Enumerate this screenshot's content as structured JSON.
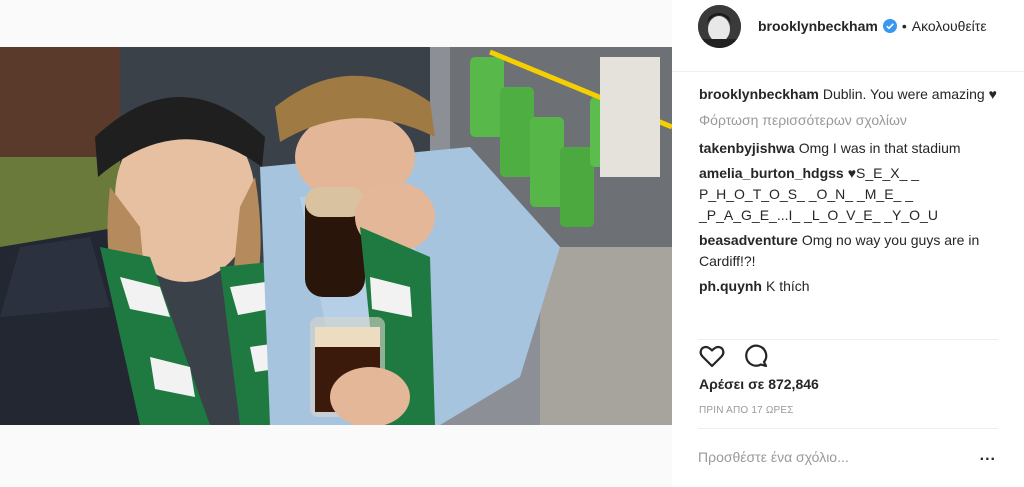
{
  "post": {
    "username": "brooklynbeckham",
    "separator": "•",
    "follow_status": "Ακολουθείτε",
    "caption_user": "brooklynbeckham",
    "caption_text": "Dublin. You were amazing ♥",
    "load_more": "Φόρτωση περισσότερων σχολίων",
    "comments": [
      {
        "user": "takenbyjishwa",
        "text": "Omg I was in that stadium"
      },
      {
        "user": "amelia_burton_hdgss",
        "text": "♥S_E_X_ _ P_H_O_T_O_S_ _O_N_ _M_E_ _ _P_A_G_E_...I_ _L_O_V_E_ _Y_O_U"
      },
      {
        "user": "beasadventure",
        "text": "Omg no way you guys are in Cardiff!?!"
      },
      {
        "user": "ph.quynh",
        "text": "K thích"
      }
    ],
    "likes": "Αρέσει σε 872,846",
    "timestamp": "ΠΡΙΝ ΑΠΟ 17 ΩΡΕΣ",
    "comment_placeholder": "Προσθέστε ένα σχόλιο...",
    "more_options": "..."
  },
  "icons": {
    "verified": "verified-badge-icon",
    "like": "heart-icon",
    "comment": "comment-bubble-icon",
    "user_tag": "user-tag-icon"
  },
  "colors": {
    "verified_blue": "#3897f0",
    "muted_text": "#999999",
    "primary_text": "#262626",
    "divider": "#efefef"
  }
}
